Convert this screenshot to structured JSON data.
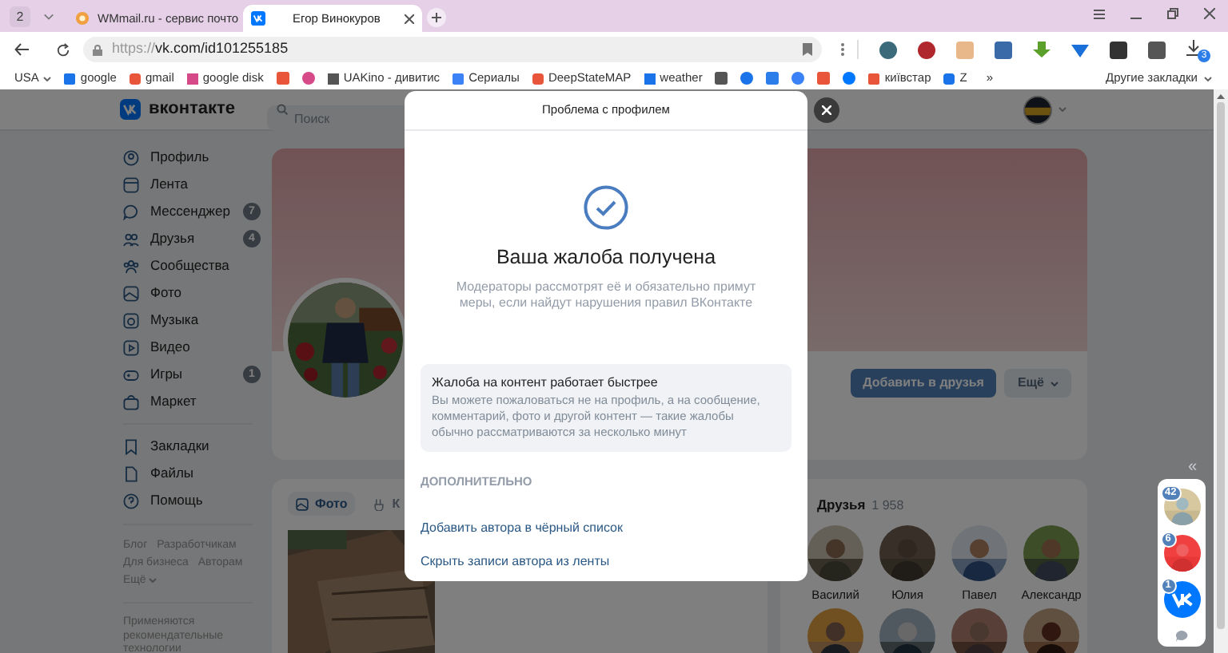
{
  "browser": {
    "tab_count": "2",
    "tabs": [
      {
        "title": "WMmail.ru - сервис почто",
        "selected": false
      },
      {
        "title": "Егор Винокуров",
        "selected": true
      }
    ],
    "address": {
      "scheme": "https://",
      "rest": "vk.com/id101255185"
    },
    "downloads_badge": "3",
    "bookmarks": [
      {
        "kind": "dropdown",
        "label": "USA"
      },
      {
        "kind": "link",
        "label": "google"
      },
      {
        "kind": "link",
        "label": "gmail"
      },
      {
        "kind": "link",
        "label": "google disk"
      },
      {
        "kind": "icon"
      },
      {
        "kind": "icon"
      },
      {
        "kind": "link",
        "label": "UAKino - дивитис"
      },
      {
        "kind": "link",
        "label": "Сериалы"
      },
      {
        "kind": "link",
        "label": "DeepStateMAP"
      },
      {
        "kind": "link",
        "label": "weather"
      },
      {
        "kind": "icon"
      },
      {
        "kind": "icon"
      },
      {
        "kind": "icon"
      },
      {
        "kind": "icon"
      },
      {
        "kind": "icon"
      },
      {
        "kind": "icon"
      },
      {
        "kind": "link",
        "label": "київстар"
      },
      {
        "kind": "link",
        "label": "Z"
      }
    ],
    "bookmarks_overflow": "»",
    "other_bookmarks": "Другие закладки"
  },
  "vk": {
    "logo_text": "вконтакте",
    "search_placeholder": "Поиск",
    "sidebar": {
      "items": [
        {
          "label": "Профиль"
        },
        {
          "label": "Лента"
        },
        {
          "label": "Мессенджер",
          "badge": "7"
        },
        {
          "label": "Друзья",
          "badge": "4"
        },
        {
          "label": "Сообщества"
        },
        {
          "label": "Фото"
        },
        {
          "label": "Музыка"
        },
        {
          "label": "Видео"
        },
        {
          "label": "Игры",
          "badge": "1"
        },
        {
          "label": "Маркет"
        }
      ],
      "secondary": [
        {
          "label": "Закладки"
        },
        {
          "label": "Файлы"
        },
        {
          "label": "Помощь"
        }
      ],
      "footer_links": [
        "Блог",
        "Разработчикам",
        "Для бизнеса",
        "Авторам"
      ],
      "more": "Ещё",
      "note": "Применяются рекомендательные технологии"
    },
    "profile": {
      "add_friend": "Добавить в друзья",
      "more": "Ещё"
    },
    "content_tabs": [
      {
        "label": "Фото",
        "selected": true
      },
      {
        "label": "К",
        "selected": false
      }
    ],
    "friends": {
      "title": "Друзья",
      "count": "1 958",
      "people": [
        "Василий",
        "Юлия",
        "Павел",
        "Александр"
      ]
    },
    "collapse": "«",
    "chats": [
      {
        "badge": "42"
      },
      {
        "badge": "6"
      },
      {
        "badge": "1"
      }
    ]
  },
  "modal": {
    "title": "Проблема с профилем",
    "heading": "Ваша жалоба получена",
    "message": "Модераторы рассмотрят её и обязательно примут меры, если найдут нарушения правил ВКонтакте",
    "info": {
      "title": "Жалоба на контент работает быстрее",
      "body": "Вы можете пожаловаться не на профиль, а на сообщение, комментарий, фото и другой контент — такие жалобы обычно рассматриваются за несколько минут"
    },
    "section": "ДОПОЛНИТЕЛЬНО",
    "links": [
      "Добавить автора в чёрный список",
      "Скрыть записи автора из ленты"
    ]
  }
}
